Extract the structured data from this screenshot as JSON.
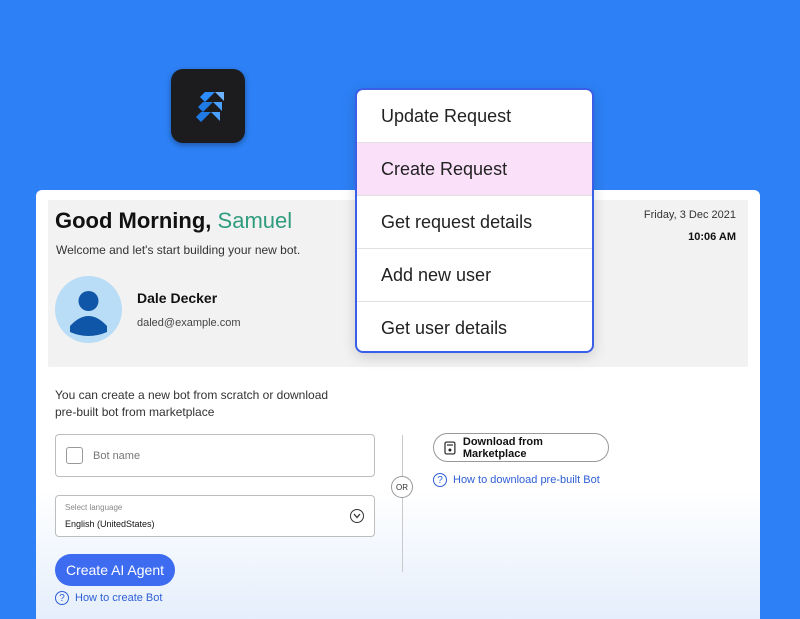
{
  "app": {
    "icon_name": "jira-icon"
  },
  "greeting": {
    "prefix": "Good Morning,",
    "name": "Samuel",
    "name_color": "#2f9c7e"
  },
  "welcome_text": "Welcome and let's start building your new bot.",
  "user": {
    "name": "Dale Decker",
    "email": "daled@example.com"
  },
  "datetime": {
    "date": "Friday, 3 Dec 2021",
    "time": "10:06 AM"
  },
  "create_section": {
    "intro_line1": "You can create a new bot from scratch or download",
    "intro_line2": "pre-built bot from marketplace",
    "bot_name_placeholder": "Bot name",
    "language_caption": "Select language",
    "language_value": "English (UnitedStates)",
    "create_button": "Create AI Agent",
    "create_button_color": "#3d6cf0",
    "help_link": "How to create Bot"
  },
  "or_label": "OR",
  "marketplace": {
    "button_label": "Download from Marketplace",
    "help_link": "How to download pre-built Bot"
  },
  "dropdown": {
    "border_color": "#3a5ee8",
    "highlight_color": "#fbe0fa",
    "items": [
      {
        "label": "Update Request"
      },
      {
        "label": "Create Request",
        "highlighted": true
      },
      {
        "label": "Get request details"
      },
      {
        "label": "Add new user"
      },
      {
        "label": "Get user details"
      }
    ]
  },
  "background_color": "#2d80f5"
}
